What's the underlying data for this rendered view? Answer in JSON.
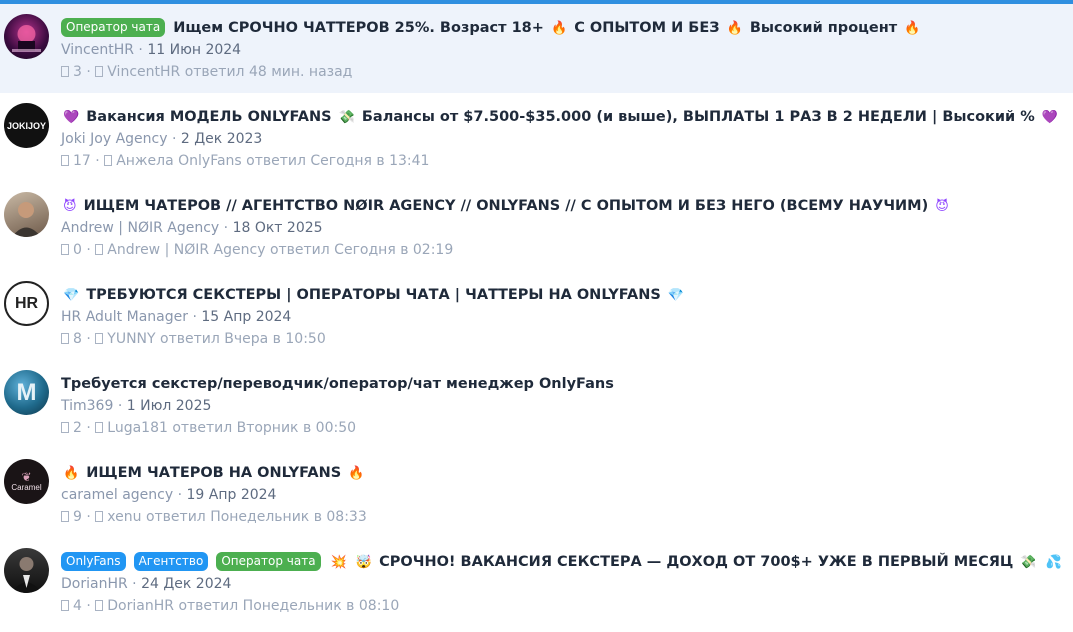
{
  "colors": {
    "accent": "#2f8fe0",
    "prefix_green": "#4caf50",
    "prefix_blue": "#2196f3",
    "highlight_row": "#eef3fb"
  },
  "threads": [
    {
      "prefixes": [
        {
          "label": "Оператор чата",
          "color": "green"
        }
      ],
      "title_parts": [
        "Ищем СРОЧНО ЧАТТЕРОВ 25%. Возраст 18+",
        "С ОПЫТОМ И БЕЗ",
        "Высокий процент"
      ],
      "emoji": [
        "🔥",
        "🔥",
        "🔥"
      ],
      "author": "VincentHR",
      "date": "11 Июн 2024",
      "replies": "3",
      "last_poster": "VincentHR",
      "last_action": "ответил 48 мин. назад",
      "avatar_icon": "avatar-image"
    },
    {
      "title_parts": [
        "Вакансия МОДЕЛЬ ONLYFANS",
        "Балансы от $7.500-$35.000 (и выше), ВЫПЛАТЫ 1 РАЗ В 2 НЕДЕЛИ | Высокий %"
      ],
      "emoji": [
        "💜",
        "💸",
        "💜"
      ],
      "author": "Joki Joy Agency",
      "date": "2 Дек 2023",
      "replies": "17",
      "last_poster": "Анжела OnlyFans",
      "last_action": "ответил Сегодня в 13:41",
      "avatar_text": "JOKIJOY"
    },
    {
      "title_parts": [
        "ИЩЕМ ЧАТЕРОВ // АГЕНТСТВО NØIR AGENCY // ONLYFANS // С ОПЫТОМ И БЕЗ НЕГО (ВСЕМУ НАУЧИМ)"
      ],
      "emoji": [
        "😈",
        "😈"
      ],
      "author": "Andrew | NØIR Agency",
      "date": "18 Окт 2025",
      "replies": "0",
      "last_poster": "Andrew | NØIR Agency",
      "last_action": "ответил Сегодня в 02:19",
      "avatar_icon": "avatar-photo"
    },
    {
      "title_parts": [
        "ТРЕБУЮТСЯ СЕКСТЕРЫ | ОПЕРАТОРЫ ЧАТА | ЧАТТЕРЫ НА ONLYFANS"
      ],
      "emoji": [
        "💎",
        "💎"
      ],
      "author": "HR Adult Manager",
      "date": "15 Апр 2024",
      "replies": "8",
      "last_poster": "YUNNY",
      "last_action": "ответил Вчера в 10:50",
      "avatar_text": "HR"
    },
    {
      "title_parts": [
        "Требуется секстер/переводчик/оператор/чат менеджер OnlyFans"
      ],
      "author": "Tim369",
      "date": "1 Июл 2025",
      "replies": "2",
      "last_poster": "Luga181",
      "last_action": "ответил Вторник в 00:50",
      "avatar_text": "M"
    },
    {
      "title_parts": [
        "ИЩЕМ ЧАТЕРОВ НА ONLYFANS"
      ],
      "emoji": [
        "🔥",
        "🔥"
      ],
      "author": "caramel agency",
      "date": "19 Апр 2024",
      "replies": "9",
      "last_poster": "xenu",
      "last_action": "ответил Понедельник в 08:33",
      "avatar_text": "Caramel"
    },
    {
      "prefixes": [
        {
          "label": "OnlyFans",
          "color": "blue"
        },
        {
          "label": "Агентство",
          "color": "blue"
        },
        {
          "label": "Оператор чата",
          "color": "green"
        }
      ],
      "title_parts": [
        "СРОЧНО! ВАКАНСИЯ СЕКСТЕРА — ДОХОД ОТ 700$+ УЖЕ В ПЕРВЫЙ МЕСЯЦ"
      ],
      "emoji": [
        "💥",
        "🤯",
        "💸",
        "💦"
      ],
      "author": "DorianHR",
      "date": "24 Дек 2024",
      "replies": "4",
      "last_poster": "DorianHR",
      "last_action": "ответил Понедельник в 08:10",
      "avatar_icon": "avatar-photo"
    }
  ]
}
